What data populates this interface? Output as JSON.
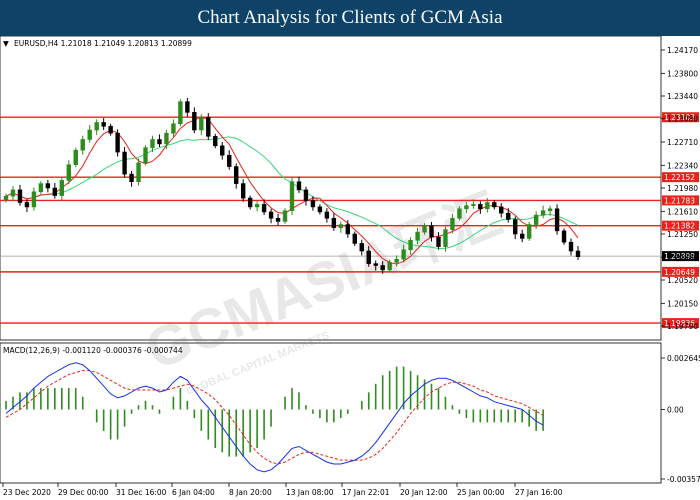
{
  "header": {
    "title": "Chart Analysis for Clients of GCM Asia"
  },
  "price_info": {
    "text": "EURUSD,H4  1.21018 1.21049 1.20813 1.20899"
  },
  "macd_info": {
    "text": "MACD(12,26,9) -0.001120 -0.000376 -0.000744"
  },
  "watermark": {
    "brand": "GCMASIA环汇",
    "sub": "GLOBAL CAPITAL MARKETS"
  },
  "colors": {
    "header_bg": "#0e4267",
    "bull": "#2e8b1e",
    "bear": "#000000",
    "level": "#e8231c",
    "ma_fast": "#e8231c",
    "ma_slow": "#37d67a",
    "macd_line": "#1530e8",
    "signal": "#e8231c",
    "hist": "#2e8b1e"
  },
  "chart_data": {
    "type": "candlestick",
    "symbol": "EURUSD",
    "timeframe": "H4",
    "ylim": [
      1.2,
      1.244
    ],
    "price_ticks": [
      "1.24170",
      "1.23800",
      "1.23440",
      "1.23080",
      "1.22710",
      "1.22340",
      "1.21980",
      "1.21610",
      "1.21250",
      "1.20880",
      "1.20520",
      "1.20150",
      "1.19790"
    ],
    "x_ticks": [
      "23 Dec 2020",
      "29 Dec 00:00",
      "31 Dec 16:00",
      "6 Jan 04:00",
      "8 Jan 20:00",
      "13 Jan 08:00",
      "17 Jan 22:01",
      "20 Jan 12:00",
      "25 Jan 00:00",
      "27 Jan 16:00"
    ],
    "levels": [
      {
        "price": 1.23103,
        "label": "1.23103"
      },
      {
        "price": 1.22152,
        "label": "1.22152"
      },
      {
        "price": 1.21783,
        "label": "1.21783"
      },
      {
        "price": 1.21382,
        "label": "1.21382"
      },
      {
        "price": 1.20649,
        "label": "1.20649"
      },
      {
        "price": 1.19836,
        "label": "1.19836"
      }
    ],
    "current_price": {
      "price": 1.20899,
      "label": "1.20899"
    },
    "closes": [
      1.2185,
      1.2195,
      1.2175,
      1.2168,
      1.2192,
      1.2205,
      1.2198,
      1.2186,
      1.221,
      1.2235,
      1.2258,
      1.2275,
      1.229,
      1.2302,
      1.2296,
      1.2285,
      1.2255,
      1.222,
      1.2208,
      1.2238,
      1.2262,
      1.2275,
      1.2268,
      1.2285,
      1.23,
      1.2335,
      1.2318,
      1.229,
      1.231,
      1.228,
      1.2265,
      1.225,
      1.2232,
      1.2205,
      1.2182,
      1.2168,
      1.2172,
      1.216,
      1.215,
      1.2145,
      1.2162,
      1.2208,
      1.2195,
      1.2178,
      1.2168,
      1.216,
      1.215,
      1.2135,
      1.214,
      1.2125,
      1.211,
      1.2098,
      1.2078,
      1.2075,
      1.2068,
      1.208,
      1.2085,
      1.21,
      1.2115,
      1.2128,
      1.2138,
      1.212,
      1.2105,
      1.2132,
      1.215,
      1.2165,
      1.217,
      1.2172,
      1.2165,
      1.2175,
      1.2168,
      1.2158,
      1.2148,
      1.2125,
      1.2118,
      1.214,
      1.2155,
      1.2162,
      1.2165,
      1.213,
      1.2112,
      1.2098,
      1.2089
    ],
    "price_range_note": "",
    "macd": {
      "ylim": [
        -0.00357,
        0.002645
      ],
      "y_ticks": [
        "0.002645",
        "0.00",
        "-0.00357"
      ],
      "macd_line": [
        -0.0002,
        0.0001,
        0.0004,
        0.0007,
        0.0011,
        0.0014,
        0.0017,
        0.0019,
        0.0021,
        0.0023,
        0.0024,
        0.0023,
        0.002,
        0.0016,
        0.0012,
        0.0008,
        0.0006,
        0.0007,
        0.0009,
        0.0011,
        0.0012,
        0.0011,
        0.0009,
        0.001,
        0.0014,
        0.0017,
        0.0015,
        0.001,
        0.0005,
        0.0001,
        -0.0004,
        -0.0009,
        -0.0014,
        -0.0019,
        -0.0024,
        -0.0028,
        -0.0031,
        -0.0032,
        -0.0031,
        -0.0028,
        -0.0024,
        -0.002,
        -0.0019,
        -0.0021,
        -0.0023,
        -0.0025,
        -0.0027,
        -0.0028,
        -0.0028,
        -0.0027,
        -0.0026,
        -0.0024,
        -0.0021,
        -0.0017,
        -0.0012,
        -0.0007,
        -0.0002,
        0.0003,
        0.0007,
        0.001,
        0.0013,
        0.0015,
        0.0016,
        0.0016,
        0.0015,
        0.0013,
        0.0011,
        0.0009,
        0.0007,
        0.0006,
        0.0004,
        0.0003,
        0.0002,
        0.0001,
        0.0,
        -0.0003,
        -0.0006,
        -0.0008
      ],
      "signal_line": [
        -0.0004,
        -0.0002,
        0.0,
        0.0003,
        0.0006,
        0.0009,
        0.0012,
        0.0014,
        0.0016,
        0.0018,
        0.0019,
        0.002,
        0.002,
        0.0019,
        0.0017,
        0.0015,
        0.0013,
        0.0011,
        0.001,
        0.001,
        0.001,
        0.001,
        0.001,
        0.001,
        0.0011,
        0.0012,
        0.0013,
        0.0012,
        0.001,
        0.0008,
        0.0005,
        0.0001,
        -0.0003,
        -0.0008,
        -0.0013,
        -0.0018,
        -0.0022,
        -0.0025,
        -0.0027,
        -0.0028,
        -0.0027,
        -0.0025,
        -0.0023,
        -0.0022,
        -0.0022,
        -0.0023,
        -0.0024,
        -0.0025,
        -0.0026,
        -0.0026,
        -0.0026,
        -0.0026,
        -0.0025,
        -0.0023,
        -0.002,
        -0.0016,
        -0.0012,
        -0.0007,
        -0.0002,
        0.0002,
        0.0006,
        0.0009,
        0.0011,
        0.0013,
        0.0014,
        0.0014,
        0.0013,
        0.0012,
        0.001,
        0.0009,
        0.0007,
        0.0006,
        0.0005,
        0.0004,
        0.0003,
        0.0001,
        -0.0001,
        -0.0003
      ]
    }
  }
}
